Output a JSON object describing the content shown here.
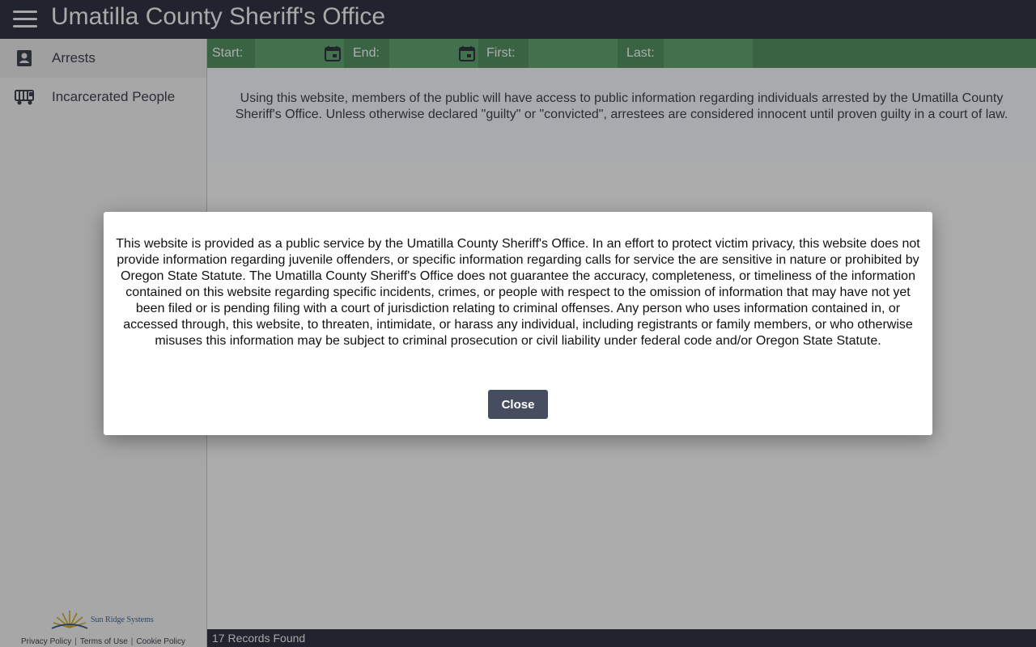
{
  "header": {
    "menu_icon": "hamburger-menu-icon",
    "title": "Umatilla County Sheriff's Office"
  },
  "sidebar": {
    "items": [
      {
        "label": "Arrests",
        "icon": "person-badge-icon",
        "active": true
      },
      {
        "label": "Incarcerated People",
        "icon": "jail-bus-icon",
        "active": false
      }
    ],
    "footer": {
      "brand": "Sun Ridge Systems",
      "links": [
        "Privacy Policy",
        "Terms of Use",
        "Cookie Policy"
      ]
    }
  },
  "filters": {
    "start_label": "Start:",
    "start_value": "",
    "end_label": "End:",
    "end_value": "",
    "first_label": "First:",
    "first_value": "",
    "last_label": "Last:",
    "last_value": "",
    "calendar_icon": "calendar-icon"
  },
  "intro_text": "Using this website, members of the public will have access to public information regarding individuals arrested by the Umatilla County Sheriff's Office. Unless otherwise declared \"guilty\" or \"convicted\", arrestees are considered innocent until proven guilty in a court of law.",
  "status": {
    "records_text": "17 Records Found"
  },
  "modal": {
    "text": "This website is provided as a public service by the Umatilla County Sheriff's Office. In an effort to protect victim privacy, this website does not provide information regarding juvenile offenders, or specific information regarding calls for service the are sensitive in nature or prohibited by Oregon State Statute. The Umatilla County Sheriff's Office does not guarantee the accuracy, completeness, or timeliness of the information contained on this website regarding specific incidents, crimes, or people with respect to the omission of information that may have not yet been filed or is pending filing with a court of jurisdiction relating to criminal offenses. Any person who uses information contained in, or accessed through, this website, to threaten, intimidate, or harass any individual, including registrants or family members, or who otherwise misuses this information may be subject to criminal prosecution or civil liability under federal code and/or Oregon State Statute.",
    "close_label": "Close"
  },
  "colors": {
    "header_bg": "#2e3340",
    "filter_bg": "#4f8a5e",
    "button_bg": "#464d5e"
  }
}
